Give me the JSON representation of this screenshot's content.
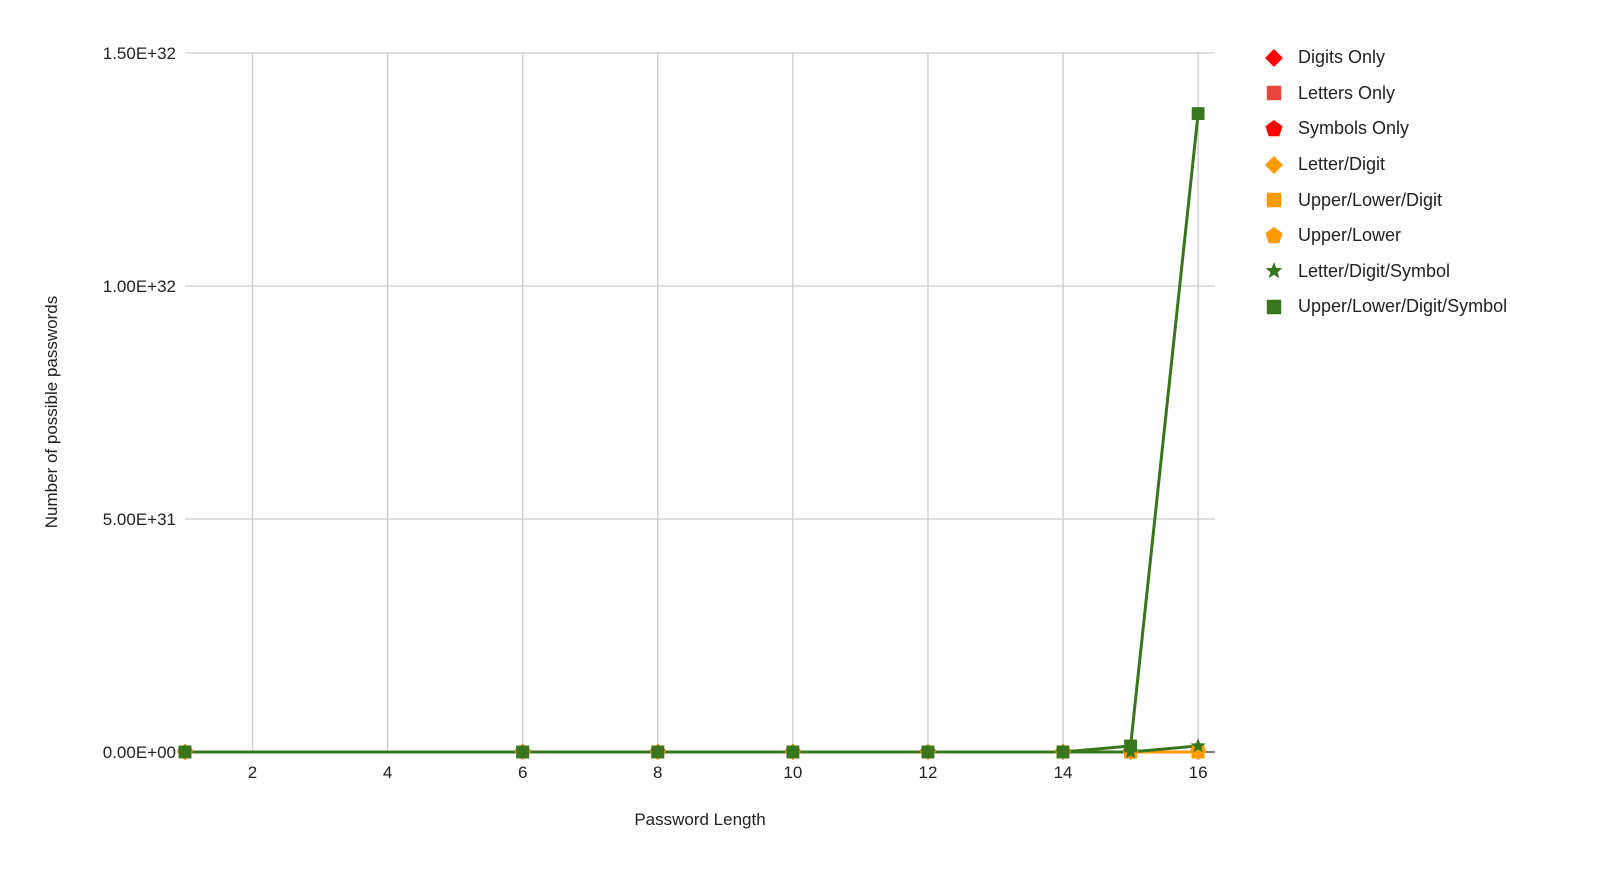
{
  "chart_data": {
    "type": "line",
    "title": "",
    "xlabel": "Password Length",
    "ylabel": "Number of possible passwords",
    "xlim": [
      1,
      16.25
    ],
    "ylim": [
      0,
      1.5e+32
    ],
    "grid": true,
    "legend_position": "right",
    "x_ticks": [
      2,
      4,
      6,
      8,
      10,
      12,
      14,
      16
    ],
    "x_tick_labels": [
      "2",
      "4",
      "6",
      "8",
      "10",
      "12",
      "14",
      "16"
    ],
    "y_ticks": [
      0,
      5e+31,
      1e+32,
      1.5e+32
    ],
    "y_tick_labels": [
      "0.00E+00",
      "5.00E+31",
      "1.00E+32",
      "1.50E+32"
    ],
    "x": [
      1,
      6,
      8,
      10,
      12,
      14,
      15,
      16
    ],
    "series": [
      {
        "name": "Digits Only",
        "color": "#ff0000",
        "marker": "diamond",
        "values": [
          0,
          0,
          0,
          0,
          0,
          0,
          0,
          0
        ]
      },
      {
        "name": "Letters Only",
        "color": "#e8453c",
        "marker": "square",
        "values": [
          0,
          0,
          0,
          0,
          0,
          0,
          0,
          0
        ]
      },
      {
        "name": "Symbols Only",
        "color": "#ff0000",
        "marker": "pentagon",
        "values": [
          0,
          0,
          0,
          0,
          0,
          0,
          0,
          0
        ]
      },
      {
        "name": "Letter/Digit",
        "color": "#ff9900",
        "marker": "diamond",
        "values": [
          0,
          0,
          0,
          0,
          0,
          0,
          0,
          0
        ]
      },
      {
        "name": "Upper/Lower/Digit",
        "color": "#ff9900",
        "marker": "square",
        "values": [
          0,
          0,
          0,
          0,
          0,
          0,
          0,
          0
        ]
      },
      {
        "name": "Upper/Lower",
        "color": "#ff9900",
        "marker": "pentagon",
        "values": [
          0,
          0,
          0,
          0,
          0,
          0,
          0,
          0
        ]
      },
      {
        "name": "Letter/Digit/Symbol",
        "color": "#38761d",
        "marker": "star",
        "values": [
          0,
          0,
          0,
          0,
          0,
          0,
          0,
          1.3e+30
        ]
      },
      {
        "name": "Upper/Lower/Digit/Symbol",
        "color": "#38761d",
        "marker": "square",
        "values": [
          0,
          0,
          0,
          0,
          0,
          0,
          1.3e+30,
          1.37e+32
        ]
      }
    ]
  }
}
